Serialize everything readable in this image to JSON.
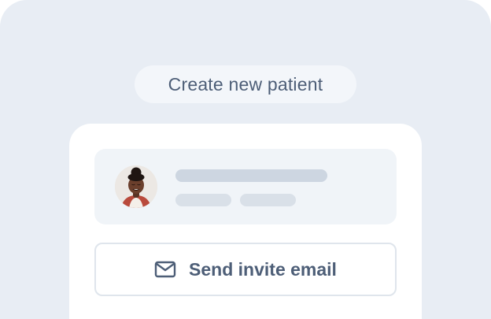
{
  "header": {
    "title": "Create new patient"
  },
  "actions": {
    "send_invite_label": "Send invite email"
  },
  "icons": {
    "invite": "mail-icon"
  },
  "colors": {
    "background": "#e8edf4",
    "text": "#4d5e77",
    "skeleton": "#cdd6e1"
  }
}
